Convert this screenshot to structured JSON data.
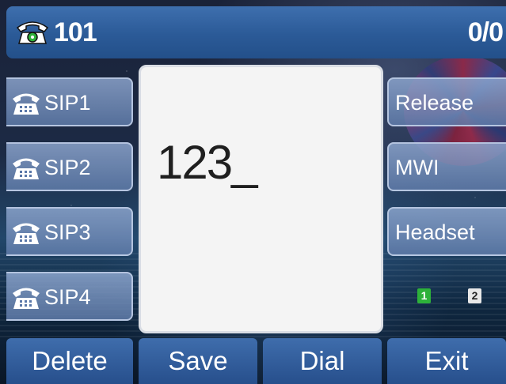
{
  "status_bar": {
    "icon": "telephone-icon",
    "title": "101",
    "count": "0/0"
  },
  "line_keys": [
    {
      "icon": "telephone-icon",
      "label": "SIP1"
    },
    {
      "icon": "telephone-icon",
      "label": "SIP2"
    },
    {
      "icon": "telephone-icon",
      "label": "SIP3"
    },
    {
      "icon": "telephone-icon",
      "label": "SIP4"
    }
  ],
  "right_keys": [
    {
      "label": "Release"
    },
    {
      "label": "MWI"
    },
    {
      "label": "Headset"
    }
  ],
  "dial": {
    "input": "123_"
  },
  "account_indicators": [
    "1",
    "2"
  ],
  "softkeys": [
    "Delete",
    "Save",
    "Dial",
    "Exit"
  ],
  "colors": {
    "status_bar": "#2b5a97",
    "softkey": "#2e5b98",
    "account_active": "#2db13a"
  }
}
